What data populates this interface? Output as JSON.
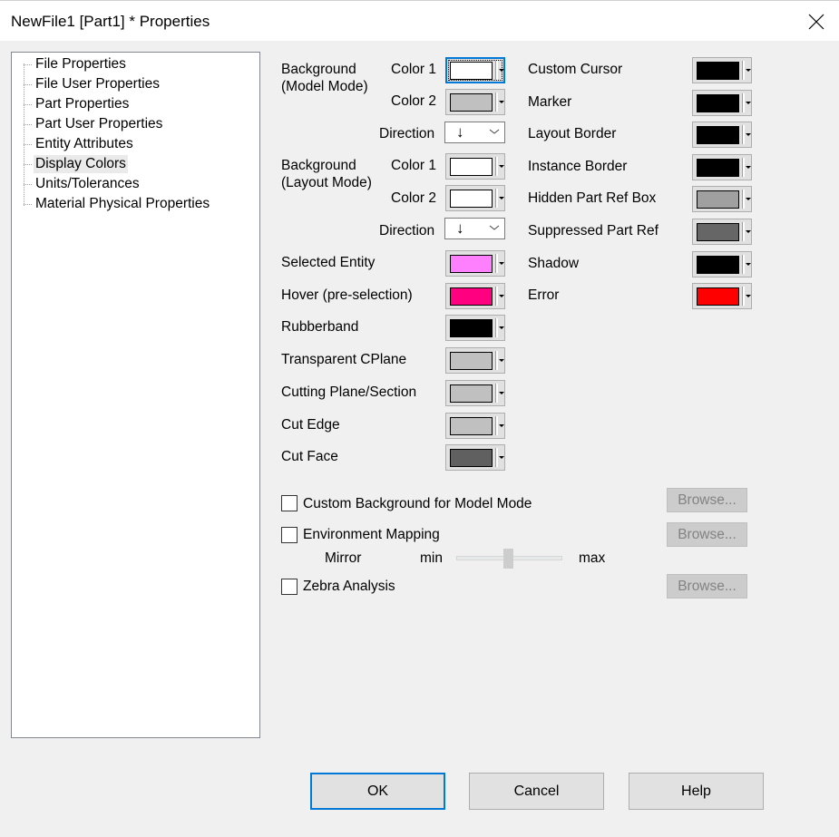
{
  "window": {
    "title": "NewFile1 [Part1] * Properties",
    "close_icon": "close-x-icon"
  },
  "tree": {
    "items": [
      {
        "label": "File Properties",
        "selected": false
      },
      {
        "label": "File User Properties",
        "selected": false
      },
      {
        "label": "Part Properties",
        "selected": false
      },
      {
        "label": "Part User Properties",
        "selected": false
      },
      {
        "label": "Entity Attributes",
        "selected": false
      },
      {
        "label": "Display Colors",
        "selected": true
      },
      {
        "label": "Units/Tolerances",
        "selected": false
      },
      {
        "label": "Material Physical Properties",
        "selected": false
      }
    ]
  },
  "background_model": {
    "label_line1": "Background",
    "label_line2": "(Model Mode)",
    "color1_label": "Color 1",
    "color1": "#ffffff",
    "color2_label": "Color 2",
    "color2": "#c0c0c0",
    "direction_label": "Direction",
    "direction_value": "↓"
  },
  "background_layout": {
    "label_line1": "Background",
    "label_line2": "(Layout Mode)",
    "color1_label": "Color 1",
    "color1": "#ffffff",
    "color2_label": "Color 2",
    "color2": "#ffffff",
    "direction_label": "Direction",
    "direction_value": "↓"
  },
  "left_colors": [
    {
      "label": "Selected Entity",
      "color": "#ff80ff"
    },
    {
      "label": "Hover (pre-selection)",
      "color": "#ff0080"
    },
    {
      "label": "Rubberband",
      "color": "#000000"
    },
    {
      "label": "Transparent CPlane",
      "color": "#c0c0c0"
    },
    {
      "label": "Cutting Plane/Section",
      "color": "#c0c0c0"
    },
    {
      "label": "Cut Edge",
      "color": "#c0c0c0"
    },
    {
      "label": "Cut Face",
      "color": "#606060"
    }
  ],
  "right_colors": [
    {
      "label": "Custom Cursor",
      "color": "#000000"
    },
    {
      "label": "Marker",
      "color": "#000000"
    },
    {
      "label": "Layout Border",
      "color": "#000000"
    },
    {
      "label": "Instance Border",
      "color": "#000000"
    },
    {
      "label": "Hidden Part Ref Box",
      "color": "#a0a0a0"
    },
    {
      "label": "Suppressed Part Ref",
      "color": "#666666"
    },
    {
      "label": "Shadow",
      "color": "#000000"
    },
    {
      "label": "Error",
      "color": "#ff0000"
    }
  ],
  "options": {
    "custom_background": {
      "label": "Custom Background for Model Mode",
      "checked": false,
      "browse_label": "Browse..."
    },
    "environment_mapping": {
      "label": "Environment Mapping",
      "checked": false,
      "browse_label": "Browse..."
    },
    "mirror": {
      "label": "Mirror",
      "min_label": "min",
      "max_label": "max",
      "value_fraction": 0.49
    },
    "zebra_analysis": {
      "label": "Zebra Analysis",
      "checked": false,
      "browse_label": "Browse..."
    }
  },
  "buttons": {
    "ok": "OK",
    "cancel": "Cancel",
    "help": "Help"
  }
}
